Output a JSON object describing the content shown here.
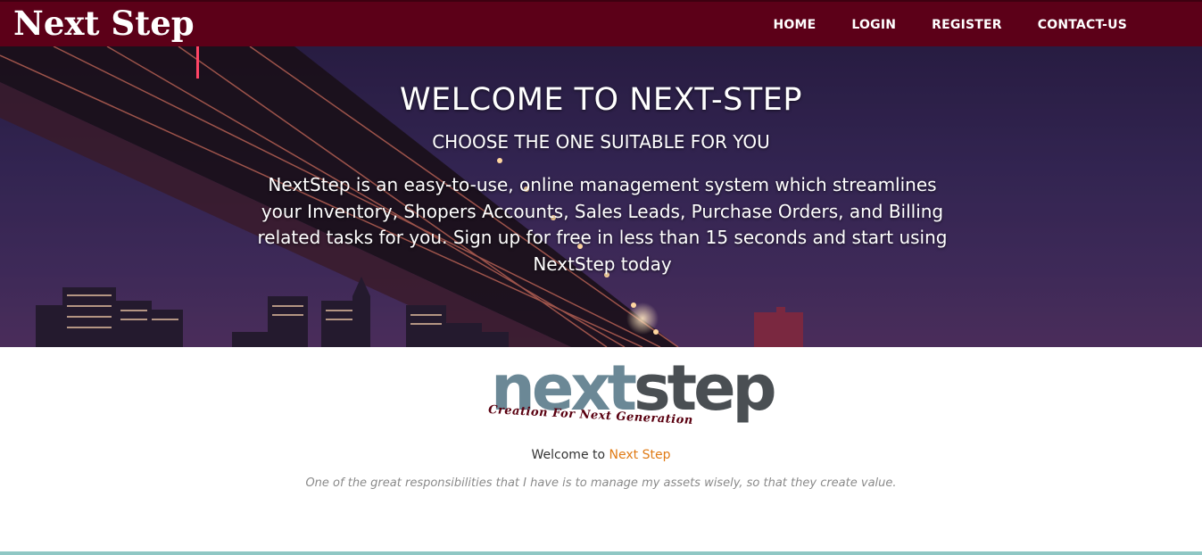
{
  "brand": {
    "name": "Next Step"
  },
  "nav": {
    "items": [
      {
        "label": "HOME"
      },
      {
        "label": "LOGIN"
      },
      {
        "label": "REGISTER"
      },
      {
        "label": "CONTACT-US"
      }
    ]
  },
  "hero": {
    "title": "WELCOME TO NEXT-STEP",
    "subtitle": "CHOOSE THE ONE SUITABLE FOR YOU",
    "description": "NextStep is an easy-to-use, online management system which streamlines your Inventory, Shopers Accounts, Sales Leads, Purchase Orders, and Billing related tasks for you. Sign up for free in less than 15 seconds and start using NextStep today"
  },
  "logo": {
    "word_part1": "next",
    "word_part2": "step",
    "tagline": "Creation For Next Generation"
  },
  "welcome": {
    "prefix": "Welcome to ",
    "accent": "Next Step",
    "quote": "One of the great responsibilities that I have is to manage my assets wisely, so that they create value."
  },
  "colors": {
    "navbar": "#5c0018",
    "accent": "#e07b16",
    "footer_line": "#8fc7c4"
  }
}
